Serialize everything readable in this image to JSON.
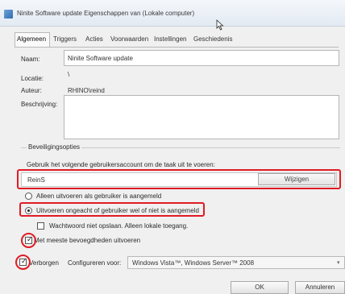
{
  "window": {
    "title": "Ninite Software update Eigenschappen van (Lokale computer)",
    "icon": "task-scheduler-icon"
  },
  "tabs": [
    "Algemeen",
    "Triggers",
    "Acties",
    "Voorwaarden",
    "Instellingen",
    "Geschiedenis"
  ],
  "general": {
    "name_label": "Naam:",
    "name_value": "Ninite Software update",
    "location_label": "Locatie:",
    "location_value": "\\",
    "author_label": "Auteur:",
    "author_value": "RHINO\\reind",
    "description_label": "Beschrijving:",
    "description_value": ""
  },
  "security": {
    "group_title": "Beveiligingsopties",
    "account_prompt": "Gebruik het volgende gebruikersaccount om de taak uit te voeren:",
    "account_value": "ReinS",
    "change_button": "Wijzigen",
    "radio_logged_on": "Alleen uitvoeren als gebruiker is aangemeld",
    "radio_whether": "Uitvoeren ongeacht of gebruiker wel of niet is aangemeld",
    "radio_selected": "radio_whether",
    "no_store_password": "Wachtwoord niet opslaan. Alleen lokale toegang.",
    "no_store_password_checked": false,
    "highest_privileges": "Met meeste bevoegdheden uitvoeren",
    "highest_privileges_checked": true
  },
  "footer": {
    "hidden_label": "Verborgen",
    "hidden_checked": true,
    "configure_label": "Configureren voor:",
    "configure_value": "Windows Vista™, Windows Server™ 2008",
    "ok_button": "OK",
    "cancel_button": "Annuleren"
  },
  "highlight_color": "#e01b24"
}
